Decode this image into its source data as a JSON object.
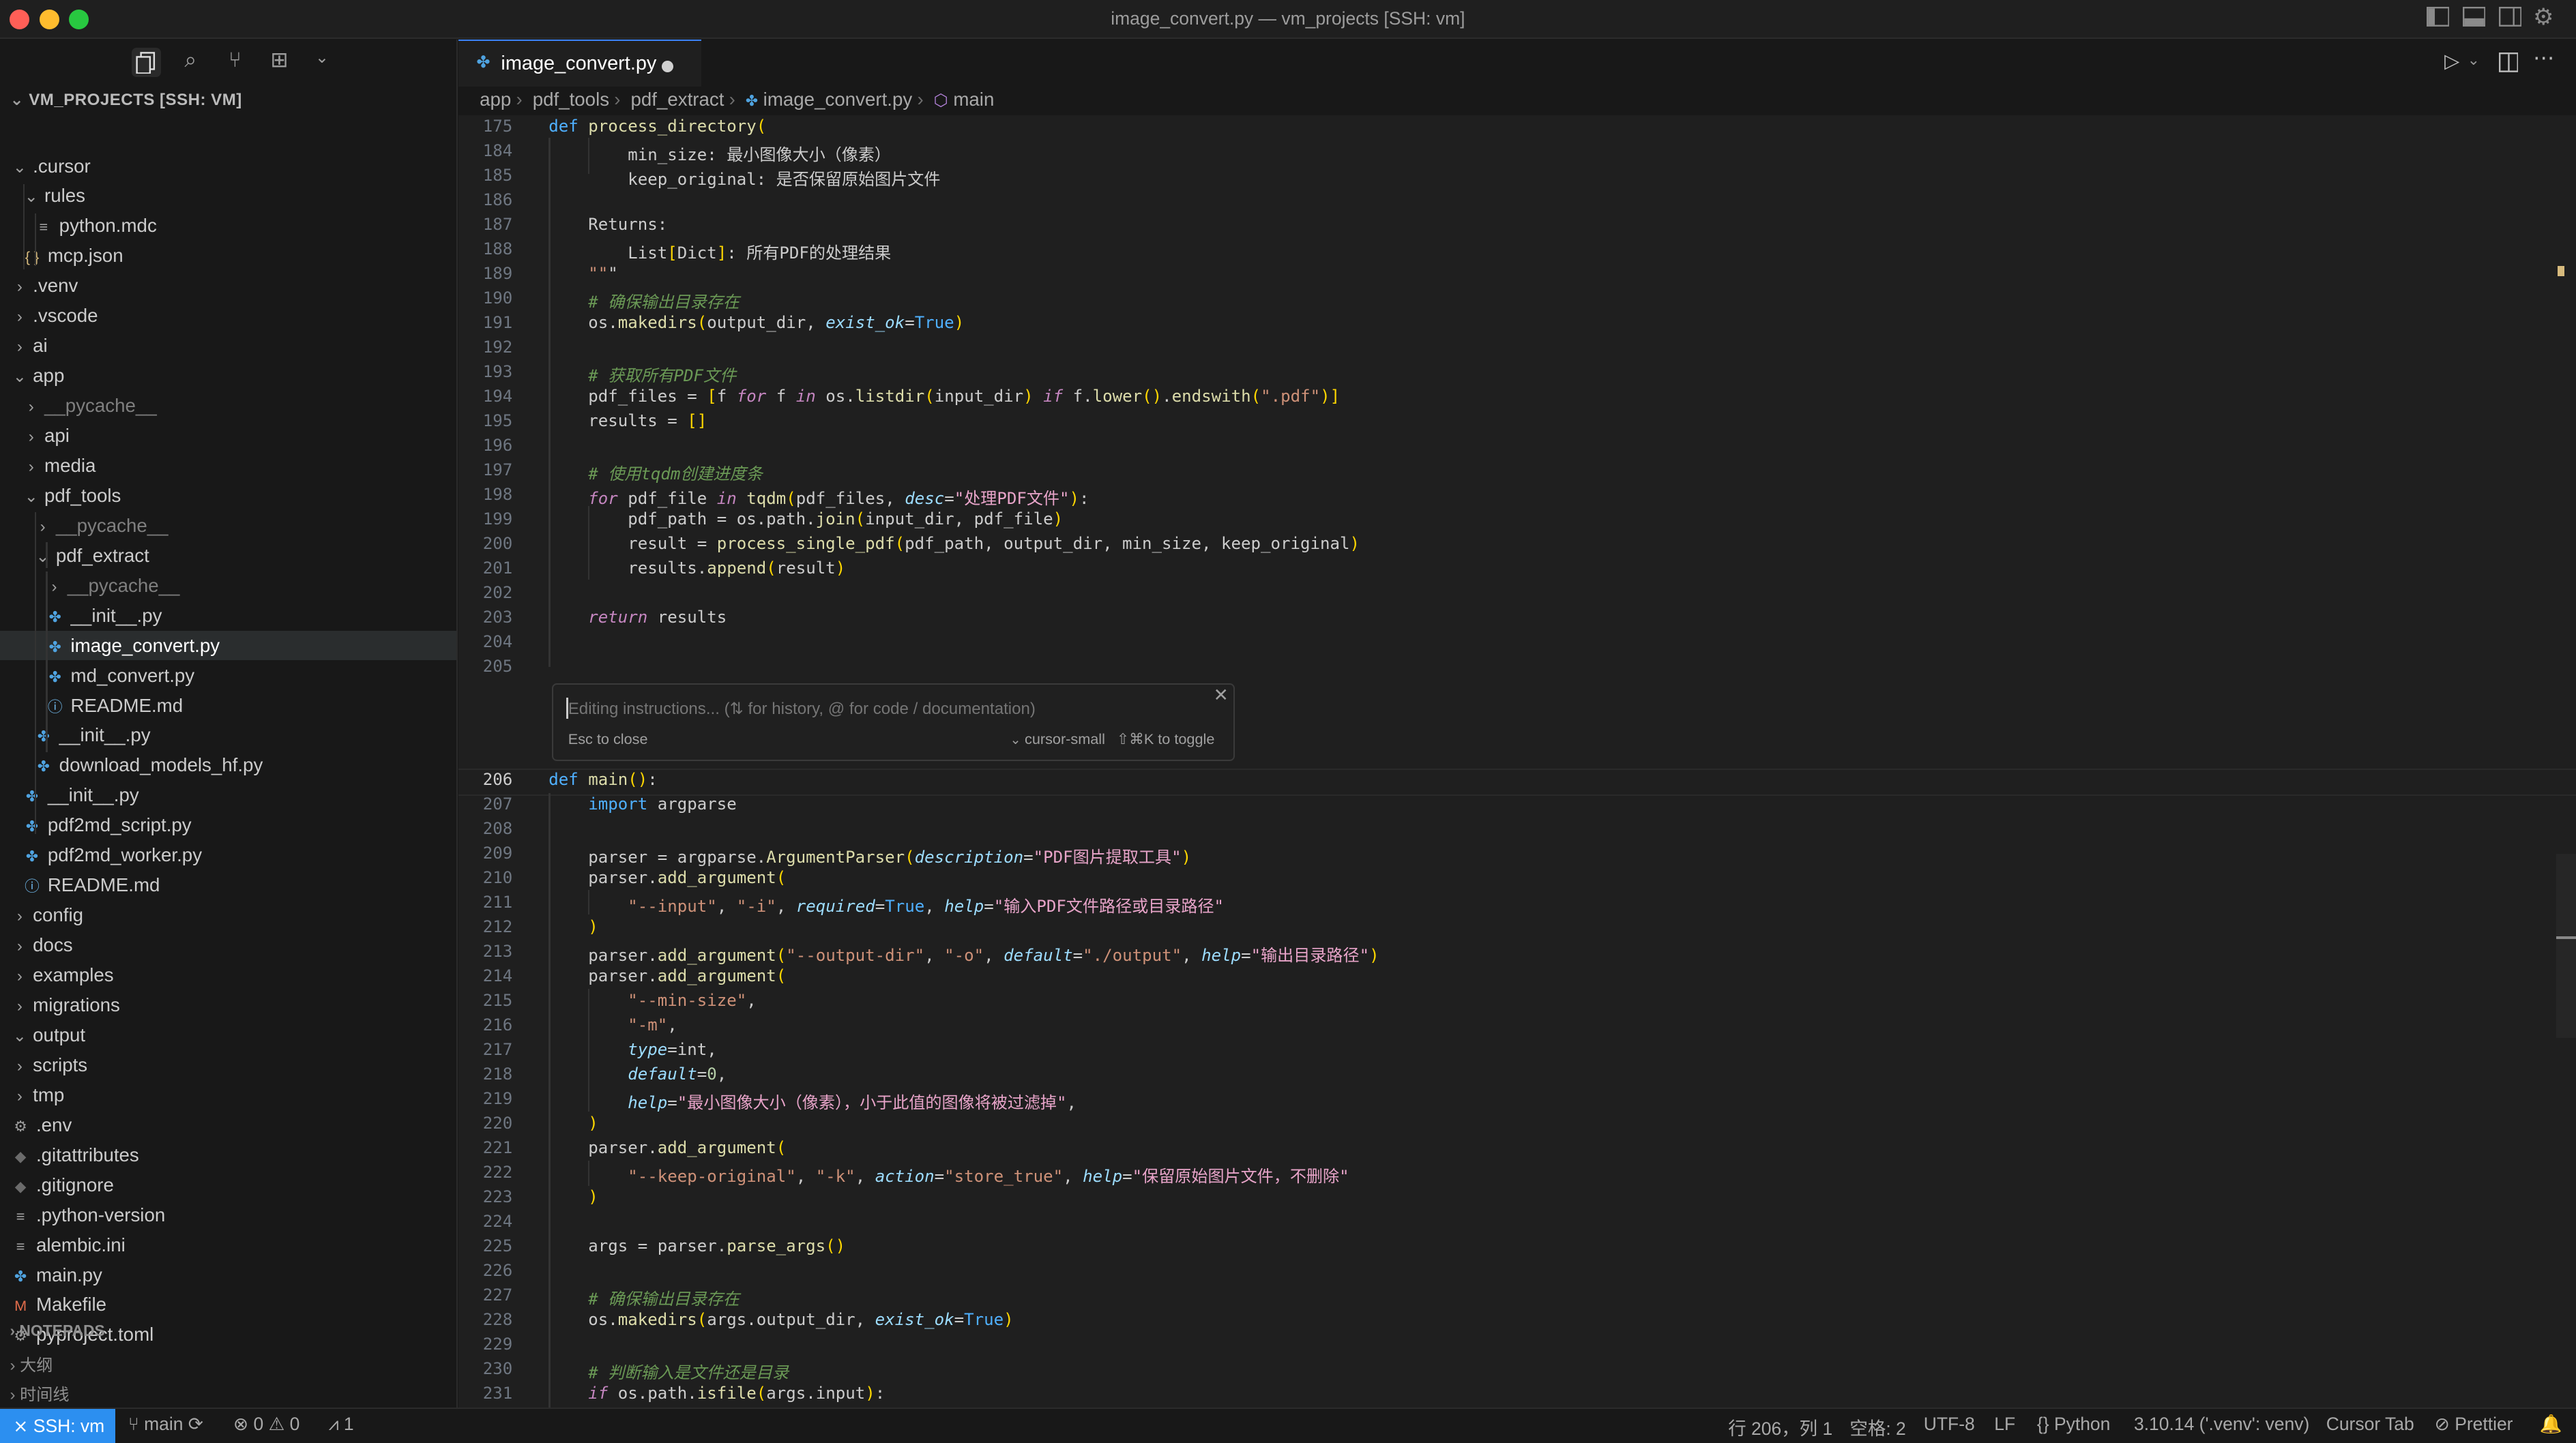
{
  "window": {
    "title": "image_convert.py — vm_projects [SSH: vm]"
  },
  "colors": {
    "accent": "#2c8ff0",
    "tl_red": "#ff5f57",
    "tl_yellow": "#febc2e",
    "tl_green": "#28c840"
  },
  "sidebar": {
    "explorer_title": "VM_PROJECTS [SSH: VM]",
    "tree": [
      {
        "label": ".cursor",
        "kind": "folder-open"
      },
      {
        "label": "rules",
        "kind": "folder-open"
      },
      {
        "label": "python.mdc",
        "kind": "file"
      },
      {
        "label": "mcp.json",
        "kind": "json"
      },
      {
        "label": ".venv",
        "kind": "folder"
      },
      {
        "label": ".vscode",
        "kind": "folder"
      },
      {
        "label": "ai",
        "kind": "folder"
      },
      {
        "label": "app",
        "kind": "folder-open"
      },
      {
        "label": "__pycache__",
        "kind": "folder"
      },
      {
        "label": "api",
        "kind": "folder"
      },
      {
        "label": "media",
        "kind": "folder"
      },
      {
        "label": "pdf_tools",
        "kind": "folder-open"
      },
      {
        "label": "__pycache__",
        "kind": "folder"
      },
      {
        "label": "pdf_extract",
        "kind": "folder-open"
      },
      {
        "label": "__pycache__",
        "kind": "folder"
      },
      {
        "label": "__init__.py",
        "kind": "py"
      },
      {
        "label": "image_convert.py",
        "kind": "py"
      },
      {
        "label": "md_convert.py",
        "kind": "py"
      },
      {
        "label": "README.md",
        "kind": "info"
      },
      {
        "label": "__init__.py",
        "kind": "py"
      },
      {
        "label": "download_models_hf.py",
        "kind": "py"
      },
      {
        "label": "__init__.py",
        "kind": "py"
      },
      {
        "label": "pdf2md_script.py",
        "kind": "py"
      },
      {
        "label": "pdf2md_worker.py",
        "kind": "py"
      },
      {
        "label": "README.md",
        "kind": "info"
      },
      {
        "label": "config",
        "kind": "folder"
      },
      {
        "label": "docs",
        "kind": "folder"
      },
      {
        "label": "examples",
        "kind": "folder"
      },
      {
        "label": "migrations",
        "kind": "folder"
      },
      {
        "label": "output",
        "kind": "folder-open"
      },
      {
        "label": "scripts",
        "kind": "folder"
      },
      {
        "label": "tmp",
        "kind": "folder"
      },
      {
        "label": ".env",
        "kind": "gear"
      },
      {
        "label": ".gitattributes",
        "kind": "git"
      },
      {
        "label": ".gitignore",
        "kind": "git"
      },
      {
        "label": ".python-version",
        "kind": "lines"
      },
      {
        "label": "alembic.ini",
        "kind": "lines"
      },
      {
        "label": "main.py",
        "kind": "py"
      },
      {
        "label": "Makefile",
        "kind": "make"
      },
      {
        "label": "pyproject.toml",
        "kind": "gear"
      }
    ],
    "notepads": "NOTEPADS",
    "outline": "大纲",
    "timeline": "时间线"
  },
  "tab": {
    "label": "image_convert.py"
  },
  "breadcrumb": [
    "app",
    "pdf_tools",
    "pdf_extract",
    "image_convert.py",
    "main"
  ],
  "editor": {
    "inline_edit": {
      "placeholder": "Editing instructions... (⇅ for history, @ for code / documentation)",
      "esc_hint": "Esc to close",
      "model": "cursor-small",
      "toggle_hint": "⇧⌘K to toggle"
    },
    "lines_top": [
      {
        "n": "175",
        "code": "def process_directory("
      },
      {
        "n": "184",
        "code": "        min_size: 最小图像大小（像素）"
      },
      {
        "n": "185",
        "code": "        keep_original: 是否保留原始图片文件"
      },
      {
        "n": "186",
        "code": ""
      },
      {
        "n": "187",
        "code": "    Returns:"
      },
      {
        "n": "188",
        "code": "        List[Dict]: 所有PDF的处理结果"
      },
      {
        "n": "189",
        "code": "    \"\"\""
      },
      {
        "n": "190",
        "code": "    # 确保输出目录存在"
      },
      {
        "n": "191",
        "code": "    os.makedirs(output_dir, exist_ok=True)"
      },
      {
        "n": "192",
        "code": ""
      },
      {
        "n": "193",
        "code": "    # 获取所有PDF文件"
      },
      {
        "n": "194",
        "code": "    pdf_files = [f for f in os.listdir(input_dir) if f.lower().endswith(\".pdf\")]"
      },
      {
        "n": "195",
        "code": "    results = []"
      },
      {
        "n": "196",
        "code": ""
      },
      {
        "n": "197",
        "code": "    # 使用tqdm创建进度条"
      },
      {
        "n": "198",
        "code": "    for pdf_file in tqdm(pdf_files, desc=\"处理PDF文件\"):"
      },
      {
        "n": "199",
        "code": "        pdf_path = os.path.join(input_dir, pdf_file)"
      },
      {
        "n": "200",
        "code": "        result = process_single_pdf(pdf_path, output_dir, min_size, keep_original)"
      },
      {
        "n": "201",
        "code": "        results.append(result)"
      },
      {
        "n": "202",
        "code": ""
      },
      {
        "n": "203",
        "code": "    return results"
      },
      {
        "n": "204",
        "code": ""
      },
      {
        "n": "205",
        "code": ""
      }
    ],
    "lines_bottom": [
      {
        "n": "206",
        "code": "def main():"
      },
      {
        "n": "207",
        "code": "    import argparse"
      },
      {
        "n": "208",
        "code": ""
      },
      {
        "n": "209",
        "code": "    parser = argparse.ArgumentParser(description=\"PDF图片提取工具\")"
      },
      {
        "n": "210",
        "code": "    parser.add_argument("
      },
      {
        "n": "211",
        "code": "        \"--input\", \"-i\", required=True, help=\"输入PDF文件路径或目录路径\""
      },
      {
        "n": "212",
        "code": "    )"
      },
      {
        "n": "213",
        "code": "    parser.add_argument(\"--output-dir\", \"-o\", default=\"./output\", help=\"输出目录路径\")"
      },
      {
        "n": "214",
        "code": "    parser.add_argument("
      },
      {
        "n": "215",
        "code": "        \"--min-size\","
      },
      {
        "n": "216",
        "code": "        \"-m\","
      },
      {
        "n": "217",
        "code": "        type=int,"
      },
      {
        "n": "218",
        "code": "        default=0,"
      },
      {
        "n": "219",
        "code": "        help=\"最小图像大小（像素），小于此值的图像将被过滤掉\","
      },
      {
        "n": "220",
        "code": "    )"
      },
      {
        "n": "221",
        "code": "    parser.add_argument("
      },
      {
        "n": "222",
        "code": "        \"--keep-original\", \"-k\", action=\"store_true\", help=\"保留原始图片文件，不删除\""
      },
      {
        "n": "223",
        "code": "    )"
      },
      {
        "n": "224",
        "code": ""
      },
      {
        "n": "225",
        "code": "    args = parser.parse_args()"
      },
      {
        "n": "226",
        "code": ""
      },
      {
        "n": "227",
        "code": "    # 确保输出目录存在"
      },
      {
        "n": "228",
        "code": "    os.makedirs(args.output_dir, exist_ok=True)"
      },
      {
        "n": "229",
        "code": ""
      },
      {
        "n": "230",
        "code": "    # 判断输入是文件还是目录"
      },
      {
        "n": "231",
        "code": "    if os.path.isfile(args.input):"
      }
    ]
  },
  "statusbar": {
    "remote": "SSH: vm",
    "branch": "main",
    "errors": "0",
    "warnings": "0",
    "ports": "1",
    "position": "行 206，列 1",
    "spaces": "空格: 2",
    "encoding": "UTF-8",
    "eol": "LF",
    "language": "Python",
    "interpreter": "3.10.14 ('.venv': venv)",
    "cursor_tab": "Cursor Tab",
    "prettier": "Prettier"
  }
}
